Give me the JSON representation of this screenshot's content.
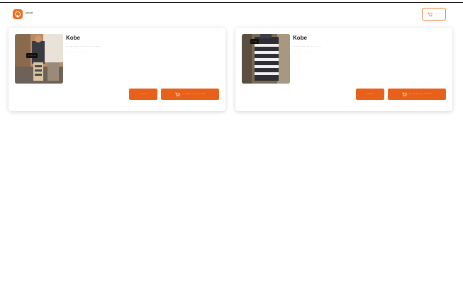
{
  "header": {
    "brand_name": "ˢᵐᵃʳᵗ",
    "logo_icon": "shopping-logo-icon",
    "cart_label": "·· ··",
    "cart_icon": "cart-icon"
  },
  "products": [
    {
      "title": "Kobe",
      "description": "·· ··· ····· ··· ··· ·· ··· ·····",
      "price": "·· ·· ·· ·· ··",
      "thumbnail_badge": "·· ·· ··",
      "view_label": "·· ···",
      "add_label": "·· ····· ·· ·· ·····"
    },
    {
      "title": "Kobe",
      "description": "·· ··· ····· ··· ··· ·· ···",
      "price": "·· ·· ·· ··",
      "thumbnail_badge": "·· ··",
      "view_label": "·· ···",
      "add_label": "·· ····· ·· ·· ·····"
    }
  ],
  "colors": {
    "accent": "#e8611a",
    "outline": "#f07c3b"
  }
}
